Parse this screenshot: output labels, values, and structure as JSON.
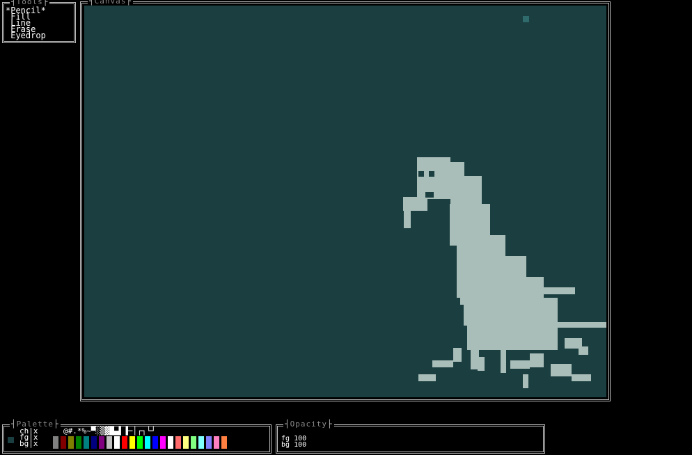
{
  "tools": {
    "title": "Tools",
    "items": [
      {
        "label": "*Pencil*"
      },
      {
        "label": " Fill"
      },
      {
        "label": " Line"
      },
      {
        "label": " Erase"
      },
      {
        "label": " Eyedrop"
      }
    ]
  },
  "canvas": {
    "title": "Canvas",
    "background": "#1b3f40",
    "ink": "#a9bdb9"
  },
  "palette": {
    "title": "Palette",
    "ch_label": "ch|x",
    "fg_label": "fg|x",
    "bg_label": "bg|x",
    "chars": "@#.*%~▀░▒▓█▄▌▐─│┌┐└┘",
    "current_fg": "#1b3f40",
    "colors": [
      "#808080",
      "#800000",
      "#808000",
      "#008000",
      "#008080",
      "#000080",
      "#800080",
      "#c0c0c0",
      "#ffffff",
      "#ff0000",
      "#ffff00",
      "#00ff00",
      "#00ffff",
      "#0000ff",
      "#ff00ff",
      "#ffffff",
      "#ff6b6b",
      "#ffff80",
      "#80ff80",
      "#80ffff",
      "#8080ff",
      "#ff80c0",
      "#ff8040"
    ]
  },
  "opacity": {
    "title": "Opacity",
    "fg_label": "fg",
    "fg_value": "100",
    "bg_label": "bg",
    "bg_value": "100"
  }
}
